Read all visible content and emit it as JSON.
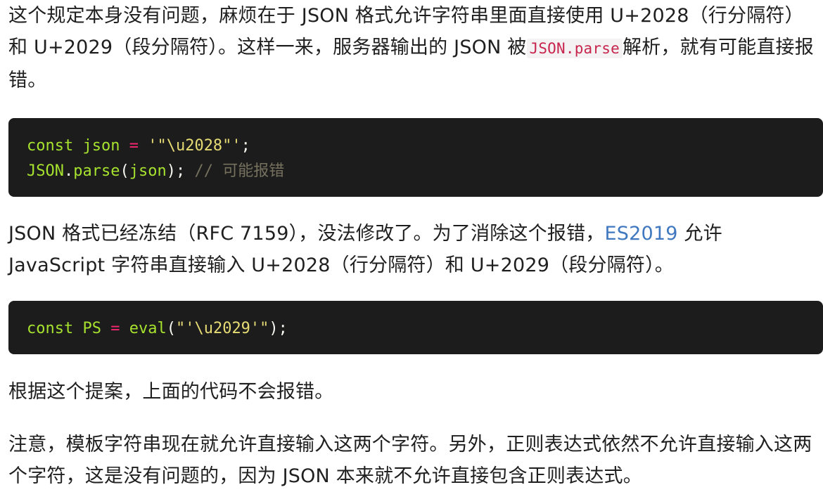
{
  "p1": {
    "text_before": "这个规定本身没有问题，麻烦在于 JSON 格式允许字符串里面直接使用 U+2028（行分隔符）和 U+2029（段分隔符）。这样一来，服务器输出的 JSON 被",
    "inline_code": "JSON.parse",
    "text_after": "解析，就有可能直接报错。"
  },
  "code1": {
    "line1": {
      "kw": "const",
      "id": "json",
      "op": "=",
      "str": "'\"\\u2028\"'",
      "end": ";"
    },
    "line2": {
      "obj": "JSON",
      "dot": ".",
      "fn": "parse",
      "open": "(",
      "arg": "json",
      "close": ");",
      "comment": "// 可能报错"
    }
  },
  "p2": {
    "text_before": "JSON 格式已经冻结（RFC 7159），没法修改了。为了消除这个报错，",
    "link": "ES2019",
    "text_after": " 允许 JavaScript 字符串直接输入 U+2028（行分隔符）和 U+2029（段分隔符）。"
  },
  "code2": {
    "kw": "const",
    "id": "PS",
    "op": "=",
    "fn": "eval",
    "open": "(",
    "str": "\"'\\u2029'\"",
    "close": ");"
  },
  "p3": {
    "text": "根据这个提案，上面的代码不会报错。"
  },
  "p4": {
    "text": "注意，模板字符串现在就允许直接输入这两个字符。另外，正则表达式依然不允许直接输入这两个字符，这是没有问题的，因为 JSON 本来就不允许直接包含正则表达式。"
  }
}
